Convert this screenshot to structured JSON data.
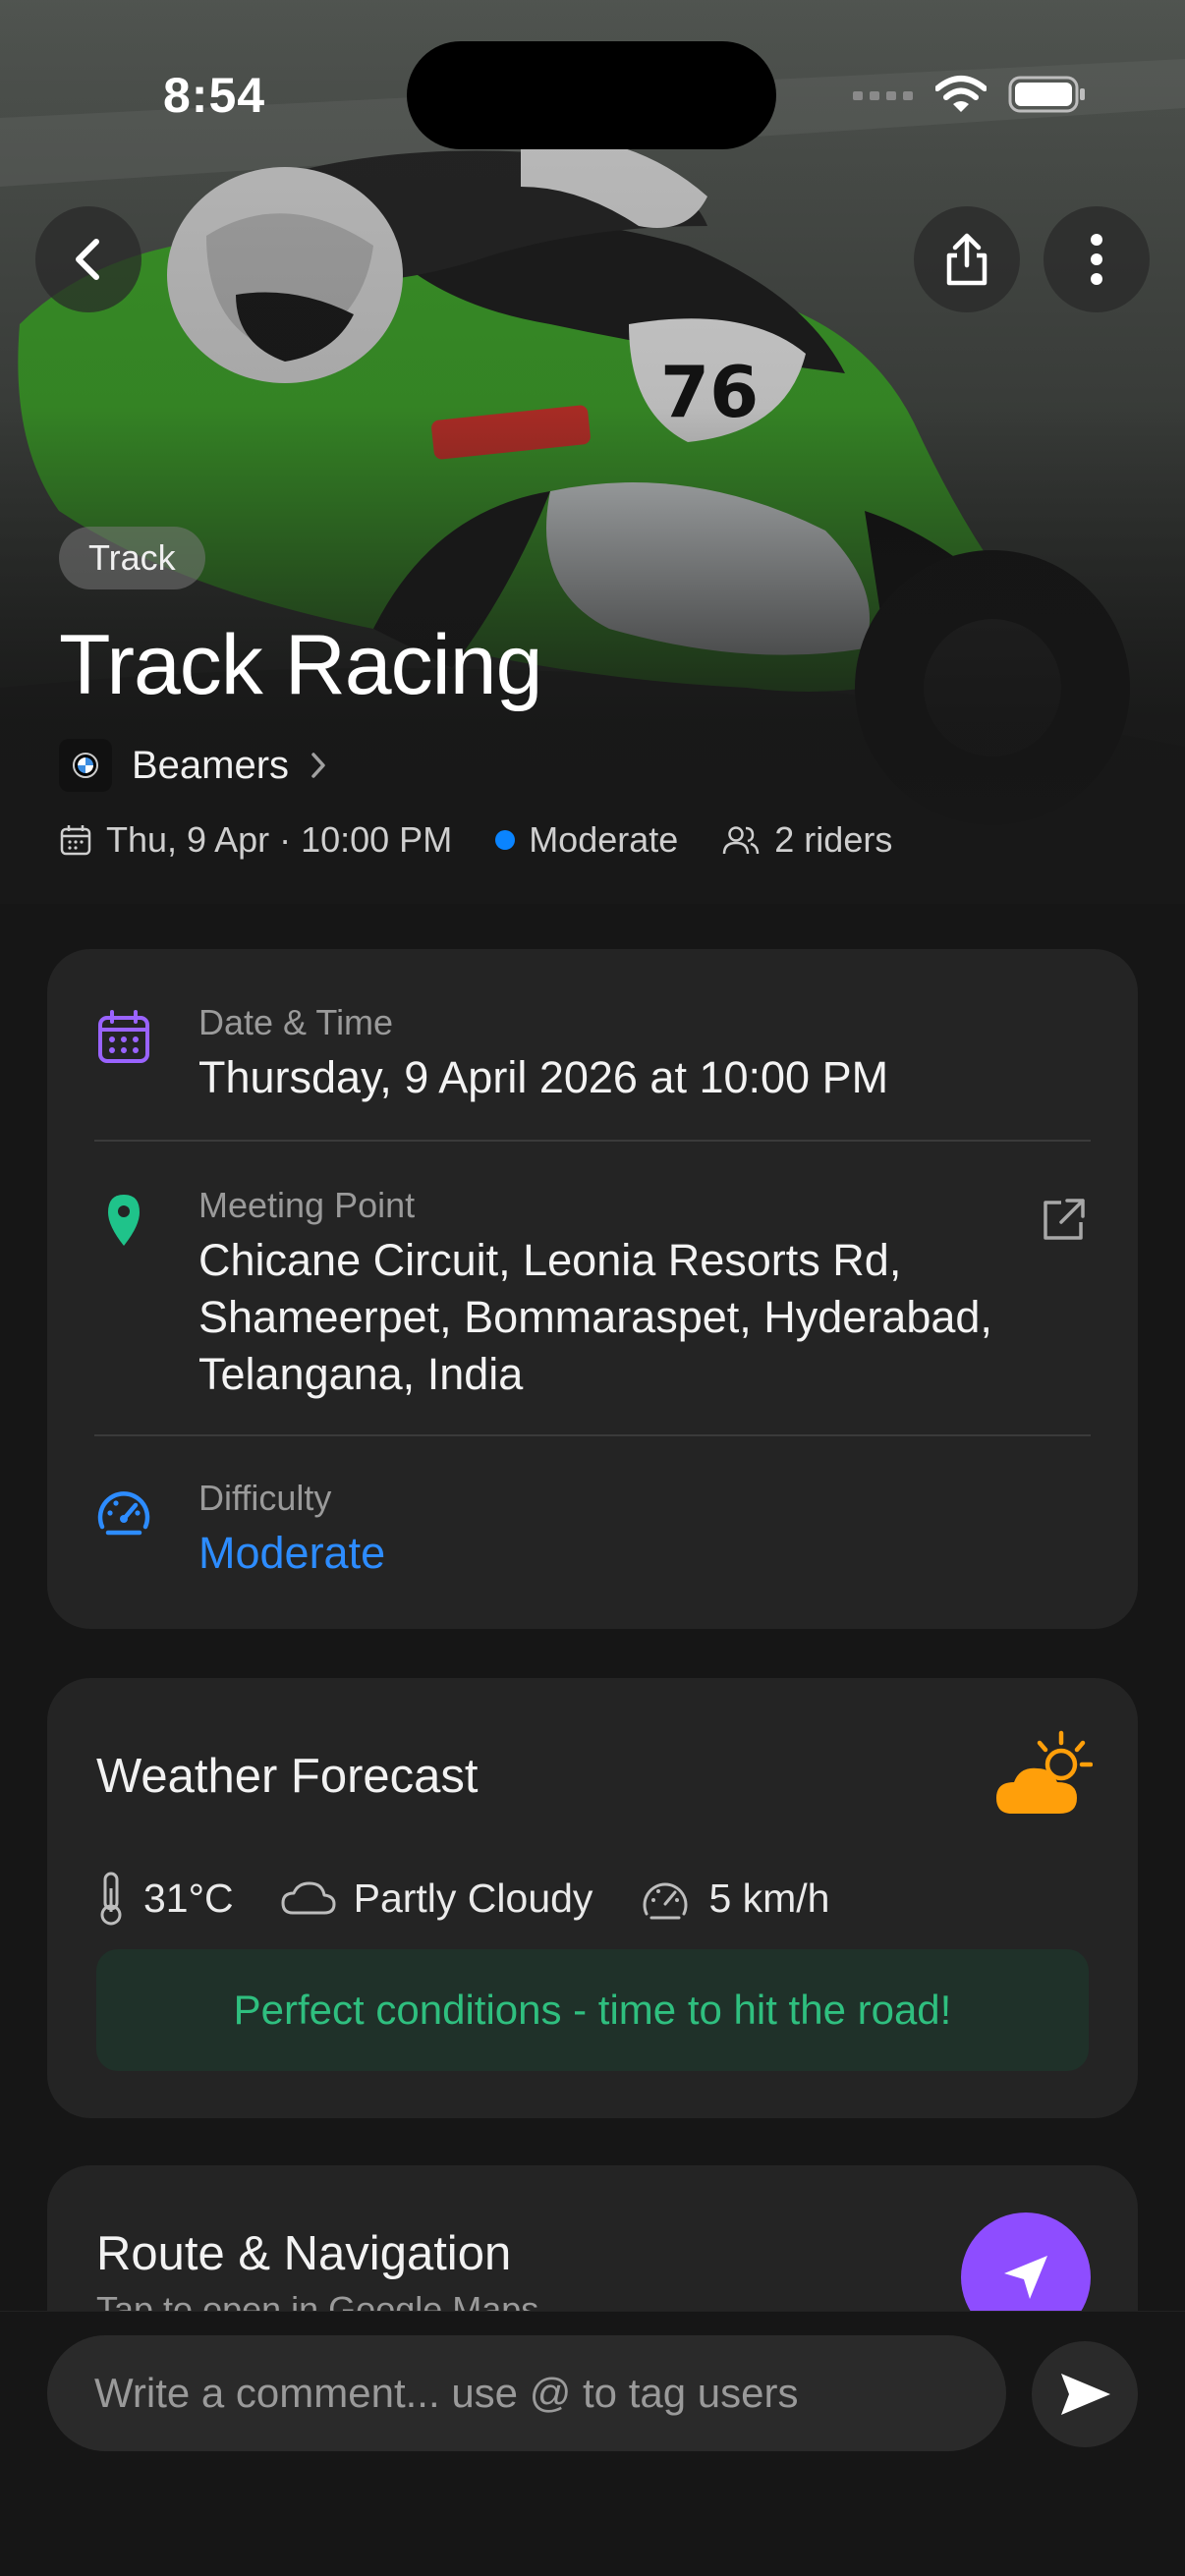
{
  "status_bar": {
    "time": "8:54"
  },
  "hero": {
    "tag": "Track",
    "title": "Track Racing",
    "organizer": "Beamers",
    "meta": {
      "datetime": "Thu, 9 Apr · 10:00 PM",
      "difficulty": "Moderate",
      "riders": "2 riders"
    }
  },
  "details": {
    "date_label": "Date & Time",
    "date_value": "Thursday, 9 April 2026 at 10:00 PM",
    "meeting_label": "Meeting Point",
    "meeting_value": "Chicane Circuit, Leonia Resorts Rd, Shameerpet, Bommaraspet, Hyderabad, Telangana, India",
    "difficulty_label": "Difficulty",
    "difficulty_value": "Moderate"
  },
  "weather": {
    "title": "Weather Forecast",
    "temperature": "31°C",
    "condition": "Partly Cloudy",
    "wind": "5 km/h",
    "message": "Perfect conditions - time to hit the road!"
  },
  "route": {
    "title": "Route & Navigation",
    "subtitle": "Tap to open in Google Maps"
  },
  "composer": {
    "placeholder": "Write a comment... use @ to tag users"
  },
  "colors": {
    "accent_purple": "#8e4dff",
    "difficulty_blue": "#2d8cff",
    "success_green": "#2fbf7f",
    "weather_orange": "#ff9f0a",
    "pin_green": "#1fc38a"
  }
}
